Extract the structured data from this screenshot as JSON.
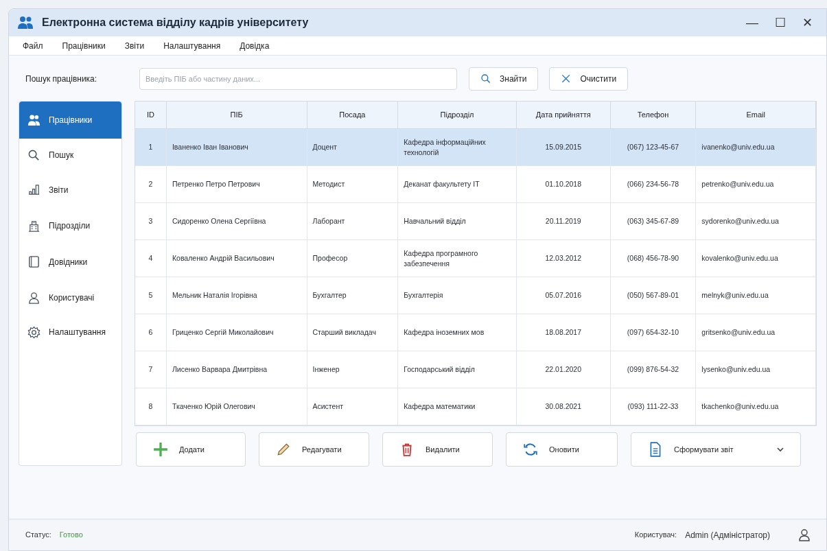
{
  "window": {
    "title": "Електронна система відділу кадрів університету",
    "controls": [
      "—",
      "☐",
      "✕"
    ]
  },
  "menu": [
    "Файл",
    "Працівники",
    "Звіти",
    "Налаштування",
    "Довідка"
  ],
  "search": {
    "label": "Пошук працівника:",
    "placeholder": "Введіть ПІБ або частину даних...",
    "buttons": [
      {
        "kind": "search",
        "label": "Знайти"
      },
      {
        "kind": "clear",
        "label": "Очистити"
      }
    ]
  },
  "sidebar": {
    "items": [
      {
        "kind": "people",
        "label": "Працівники",
        "selected": true
      },
      {
        "kind": "search",
        "label": "Пошук",
        "selected": false
      },
      {
        "kind": "chart",
        "label": "Звіти",
        "selected": false
      },
      {
        "kind": "building",
        "label": "Підрозділи",
        "selected": false
      },
      {
        "kind": "book",
        "label": "Довідники",
        "selected": false
      },
      {
        "kind": "user",
        "label": "Користувачі",
        "selected": false
      },
      {
        "kind": "gear",
        "label": "Налаштування",
        "selected": false
      }
    ]
  },
  "table": {
    "columns": [
      "ID",
      "ПІБ",
      "Посада",
      "Підрозділ",
      "Дата прийняття",
      "Телефон",
      "Email"
    ],
    "rows": [
      {
        "selected": true,
        "cells": [
          "1",
          "Іваненко Іван Іванович",
          "Доцент",
          "Кафедра інформаційних технологій",
          "15.09.2015",
          "(067) 123-45-67",
          "ivanenko@univ.edu.ua"
        ]
      },
      {
        "selected": false,
        "cells": [
          "2",
          "Петренко Петро Петрович",
          "Методист",
          "Деканат факультету IT",
          "01.10.2018",
          "(066) 234-56-78",
          "petrenko@univ.edu.ua"
        ]
      },
      {
        "selected": false,
        "cells": [
          "3",
          "Сидоренко Олена Сергіївна",
          "Лаборант",
          "Навчальний відділ",
          "20.11.2019",
          "(063) 345-67-89",
          "sydorenko@univ.edu.ua"
        ]
      },
      {
        "selected": false,
        "cells": [
          "4",
          "Коваленко Андрій Васильович",
          "Професор",
          "Кафедра програмного забезпечення",
          "12.03.2012",
          "(068) 456-78-90",
          "kovalenko@univ.edu.ua"
        ]
      },
      {
        "selected": false,
        "cells": [
          "5",
          "Мельник Наталія Ігорівна",
          "Бухгалтер",
          "Бухгалтерія",
          "05.07.2016",
          "(050) 567-89-01",
          "melnyk@univ.edu.ua"
        ]
      },
      {
        "selected": false,
        "cells": [
          "6",
          "Гриценко Сергій Миколайович",
          "Старший викладач",
          "Кафедра іноземних мов",
          "18.08.2017",
          "(097) 654-32-10",
          "gritsenko@univ.edu.ua"
        ]
      },
      {
        "selected": false,
        "cells": [
          "7",
          "Лисенко Варвара Дмитрівна",
          "Інженер",
          "Господарський відділ",
          "22.01.2020",
          "(099) 876-54-32",
          "lysenko@univ.edu.ua"
        ]
      },
      {
        "selected": false,
        "cells": [
          "8",
          "Ткаченко Юрій Олегович",
          "Асистент",
          "Кафедра математики",
          "30.08.2021",
          "(093) 111-22-33",
          "tkachenko@univ.edu.ua"
        ]
      }
    ]
  },
  "actions": [
    {
      "kind": "add",
      "label": "Додати"
    },
    {
      "kind": "edit",
      "label": "Редагувати"
    },
    {
      "kind": "delete",
      "label": "Видалити"
    },
    {
      "kind": "refresh",
      "label": "Оновити"
    },
    {
      "kind": "report",
      "label": "Сформувати звіт",
      "dropdown": true
    }
  ],
  "status_bar": {
    "status_label": "Статус:",
    "status": "Готово",
    "user_label": "Користувач:",
    "user": "Admin (Адміністратор)"
  }
}
